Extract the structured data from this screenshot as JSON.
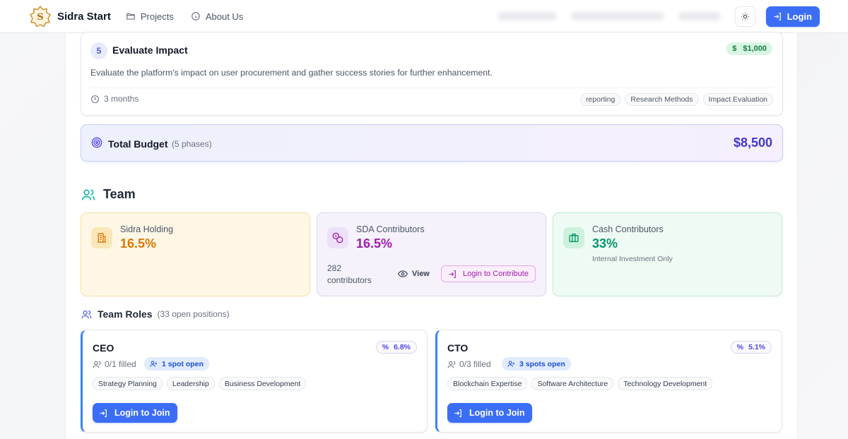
{
  "navbar": {
    "brand": "Sidra Start",
    "links": [
      {
        "label": "Projects",
        "icon": "folder-icon"
      },
      {
        "label": "About Us",
        "icon": "info-icon"
      }
    ],
    "theme_icon": "sun-icon",
    "login_label": "Login"
  },
  "phase": {
    "number": "5",
    "title": "Evaluate Impact",
    "amount": "$1,000",
    "amount_symbol": "$",
    "description": "Evaluate the platform's impact on user procurement and gather success stories for further enhancement.",
    "duration": "3 months",
    "tags": [
      "reporting",
      "Research Methods",
      "Impact Evaluation"
    ]
  },
  "budget": {
    "title": "Total Budget",
    "subtitle": "(5 phases)",
    "value": "$8,500"
  },
  "team": {
    "heading": "Team",
    "equity": [
      {
        "name": "Sidra Holding",
        "percent": "16.5%",
        "color": "#d97706"
      },
      {
        "name": "SDA Contributors",
        "percent": "16.5%",
        "color": "#a21caf",
        "contributors": "282 contributors",
        "view_label": "View",
        "contribute_label": "Login to Contribute"
      },
      {
        "name": "Cash Contributors",
        "percent": "33%",
        "color": "#059669",
        "note": "Internal Investment Only"
      }
    ]
  },
  "roles": {
    "heading": "Team Roles",
    "subheading": "(33 open positions)",
    "items": [
      {
        "title": "CEO",
        "percent": "6.8%",
        "filled": "0/1 filled",
        "spots": "1 spot open",
        "skills": [
          "Strategy Planning",
          "Leadership",
          "Business Development"
        ],
        "join_label": "Login to Join"
      },
      {
        "title": "CTO",
        "percent": "5.1%",
        "filled": "0/3 filled",
        "spots": "3 spots open",
        "skills": [
          "Blockchain Expertise",
          "Software Architecture",
          "Technology Development"
        ],
        "join_label": "Login to Join"
      }
    ]
  },
  "colors": {
    "primary": "#3b6ef5",
    "budget": "#4338ca",
    "success": "#15803d"
  }
}
